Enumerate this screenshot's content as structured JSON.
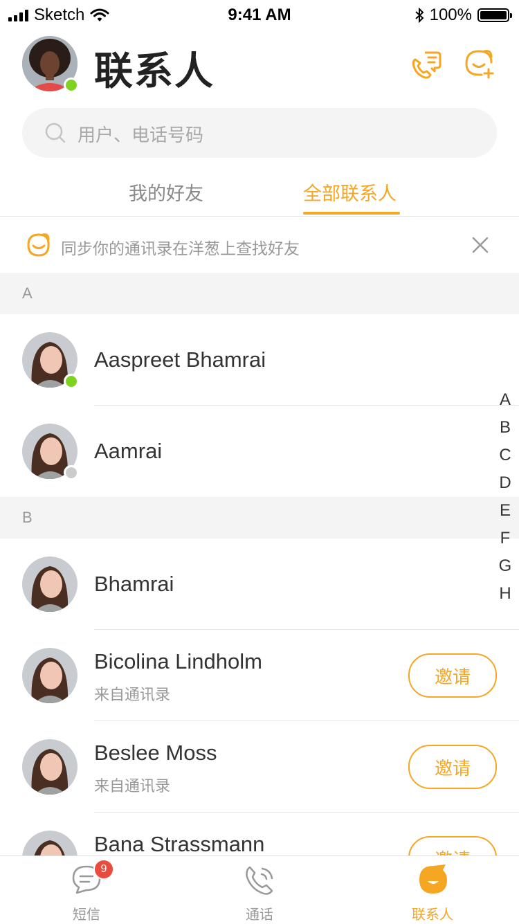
{
  "status_bar": {
    "carrier": "Sketch",
    "time": "9:41 AM",
    "battery": "100%"
  },
  "header": {
    "title": "联系人",
    "me_presence": "online"
  },
  "search": {
    "placeholder": "用户、电话号码"
  },
  "tabs": [
    {
      "label": "我的好友",
      "active": false
    },
    {
      "label": "全部联系人",
      "active": true
    }
  ],
  "banner": {
    "text": "同步你的通讯录在洋葱上查找好友"
  },
  "sections": [
    {
      "letter": "A",
      "contacts": [
        {
          "name": "Aaspreet Bhamrai",
          "subtitle": "",
          "presence": "online",
          "invite": ""
        },
        {
          "name": "Aamrai",
          "subtitle": "",
          "presence": "offline",
          "invite": ""
        }
      ]
    },
    {
      "letter": "B",
      "contacts": [
        {
          "name": "Bhamrai",
          "subtitle": "",
          "presence": "",
          "invite": ""
        },
        {
          "name": "Bicolina Lindholm",
          "subtitle": "来自通讯录",
          "presence": "",
          "invite": "邀请"
        },
        {
          "name": "Beslee Moss",
          "subtitle": "来自通讯录",
          "presence": "",
          "invite": "邀请"
        },
        {
          "name": "Bana Strassmann",
          "subtitle": "",
          "presence": "",
          "invite": "邀请"
        }
      ]
    }
  ],
  "alpha_index": [
    "A",
    "B",
    "C",
    "D",
    "E",
    "F",
    "G",
    "H"
  ],
  "tab_bar": {
    "items": [
      {
        "label": "短信",
        "icon": "message-icon",
        "badge": "9",
        "active": false
      },
      {
        "label": "通话",
        "icon": "phone-icon",
        "badge": "",
        "active": false
      },
      {
        "label": "联系人",
        "icon": "contacts-icon",
        "badge": "",
        "active": true
      }
    ]
  },
  "colors": {
    "accent": "#f5a623",
    "online": "#7ed321",
    "offline": "#cccccc",
    "badge": "#e94b3c"
  }
}
